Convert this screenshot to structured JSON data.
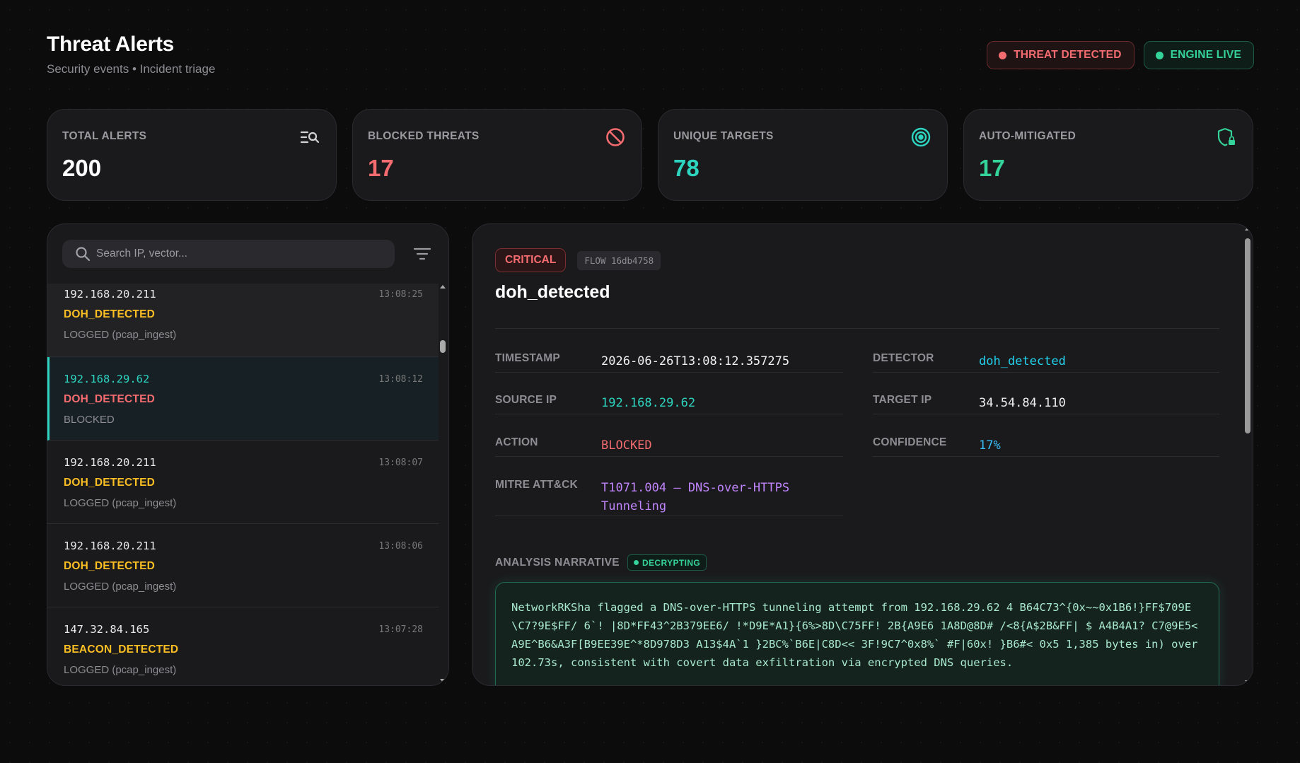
{
  "header": {
    "title": "Threat Alerts",
    "subtitle": "Security events • Incident triage"
  },
  "badges": {
    "threat": "THREAT DETECTED",
    "live": "ENGINE LIVE"
  },
  "stats": [
    {
      "label": "TOTAL ALERTS",
      "value": "200",
      "color": "#ffffff",
      "icon": "search-list-icon"
    },
    {
      "label": "BLOCKED THREATS",
      "value": "17",
      "color": "#f56c70",
      "icon": "block-icon"
    },
    {
      "label": "UNIQUE TARGETS",
      "value": "78",
      "color": "#2dd4bf",
      "icon": "target-icon"
    },
    {
      "label": "AUTO-MITIGATED",
      "value": "17",
      "color": "#34d399",
      "icon": "shield-lock-icon"
    }
  ],
  "search": {
    "placeholder": "Search IP, vector..."
  },
  "alerts": [
    {
      "ip": "192.168.20.211",
      "time": "13:08:25",
      "vector": "DOH_DETECTED",
      "vector_color": "#fbbf24",
      "status": "LOGGED (pcap_ingest)"
    },
    {
      "ip": "192.168.29.62",
      "time": "13:08:12",
      "vector": "DOH_DETECTED",
      "vector_color": "#f56c70",
      "status": "BLOCKED"
    },
    {
      "ip": "192.168.20.211",
      "time": "13:08:07",
      "vector": "DOH_DETECTED",
      "vector_color": "#fbbf24",
      "status": "LOGGED (pcap_ingest)"
    },
    {
      "ip": "192.168.20.211",
      "time": "13:08:06",
      "vector": "DOH_DETECTED",
      "vector_color": "#fbbf24",
      "status": "LOGGED (pcap_ingest)"
    },
    {
      "ip": "147.32.84.165",
      "time": "13:07:28",
      "vector": "BEACON_DETECTED",
      "vector_color": "#fbbf24",
      "status": "LOGGED (pcap_ingest)"
    }
  ],
  "detail": {
    "severity": "CRITICAL",
    "flow": "FLOW 16db4758",
    "title": "doh_detected",
    "fields": {
      "timestamp": {
        "label": "TIMESTAMP",
        "value": "2026-06-26T13:08:12.357275"
      },
      "detector": {
        "label": "DETECTOR",
        "value": "doh_detected"
      },
      "source_ip": {
        "label": "SOURCE IP",
        "value": "192.168.29.62"
      },
      "target_ip": {
        "label": "TARGET IP",
        "value": "34.54.84.110"
      },
      "action": {
        "label": "ACTION",
        "value": "BLOCKED"
      },
      "confidence": {
        "label": "CONFIDENCE",
        "value": "17%"
      },
      "mitre": {
        "label": "MITRE ATT&CK",
        "value": "T1071.004 — DNS-over-HTTPS Tunneling"
      }
    },
    "narrative_label": "ANALYSIS NARRATIVE",
    "narrative_badge": "DECRYPTING",
    "narrative": "NetworkRKSha flagged a DNS-over-HTTPS tunneling attempt from 192.168.29.62 4 B64C73^{0x~~0x1B6!}FF$709E\\C7?9E$FF/ 6`! |8D*FF43^2B379EE6/ !*D9E*A1}{6%>8D\\C75FF! 2B{A9E6 1A8D@8D# /<8{A$2B&FF| $ A4B4A1? C7@9E5<A9E^B6&A3F[B9EE39E^*8D978D3 A13$4A`1 }2BC%`B6E|C8D<< 3F!9C7^0x8%` #F|60x! }B6#< 0x5 1,385 bytes in) over 102.73s, consistent with covert data exfiltration via encrypted DNS queries."
  },
  "colors": {
    "accent_teal": "#2dd4bf",
    "accent_red": "#f56c70",
    "accent_amber": "#fbbf24",
    "accent_green": "#34d399",
    "accent_cyan": "#22d3ee",
    "accent_sky": "#38bdf8",
    "accent_purple": "#c084fc"
  }
}
